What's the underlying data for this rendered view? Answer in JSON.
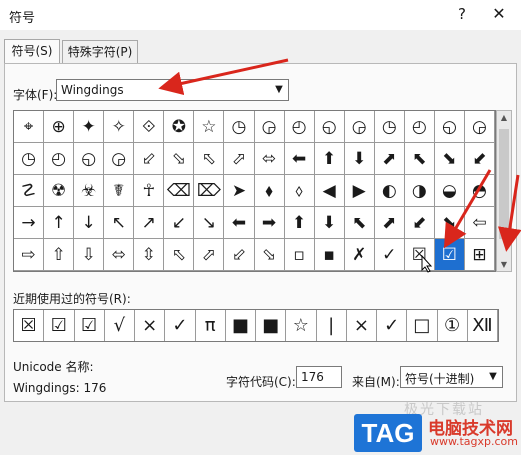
{
  "window": {
    "title": "符号",
    "help": "?",
    "close": "✕"
  },
  "tabs": [
    {
      "label": "符号(S)"
    },
    {
      "label": "特殊字符(P)"
    }
  ],
  "font": {
    "label": "字体(F):",
    "value": "Wingdings"
  },
  "symbol_grid": [
    [
      "⌖",
      "⊕",
      "✦",
      "✧",
      "⟐",
      "✪",
      "☆",
      "◷",
      "◶",
      "◴",
      "◵",
      "◶",
      "◷",
      "◴",
      "◵",
      "◶"
    ],
    [
      "◷",
      "◴",
      "◵",
      "◶",
      "⬃",
      "⬂",
      "⬁",
      "⬀",
      "⬄",
      "⬅",
      "⬆",
      "⬇",
      "⬈",
      "⬉",
      "⬊",
      "⬋"
    ],
    [
      "☡",
      "☢",
      "☣",
      "☤",
      "☥",
      "⌫",
      "⌦",
      "➤",
      "⬧",
      "⬨",
      "◀",
      "▶",
      "◐",
      "◑",
      "◒",
      "◓"
    ],
    [
      "→",
      "↑",
      "↓",
      "↖",
      "↗",
      "↙",
      "↘",
      "⬅",
      "➡",
      "⬆",
      "⬇",
      "⬉",
      "⬈",
      "⬋",
      "⬊",
      "⇦"
    ],
    [
      "⇨",
      "⇧",
      "⇩",
      "⬄",
      "⇳",
      "⬁",
      "⬀",
      "⬃",
      "⬂",
      "▫",
      "▪",
      "✗",
      "✓",
      "☒",
      "☑",
      "⊞"
    ]
  ],
  "selected_cell": "4,14",
  "recent": {
    "label": "近期使用过的符号(R):",
    "symbols": [
      "☒",
      "☑",
      "☑",
      "√",
      "×",
      "✓",
      "π",
      "■",
      "■",
      "☆",
      "|",
      "×",
      "✓",
      "□",
      "①",
      "Ⅻ"
    ]
  },
  "unicode": {
    "name_label": "Unicode 名称:",
    "value": "Wingdings: 176"
  },
  "charcode": {
    "label": "字符代码(C):",
    "value": "176"
  },
  "from": {
    "label": "来自(M):",
    "value": "符号(十进制)"
  },
  "watermark": {
    "logo": "TAG",
    "site_name": "电脑技术网",
    "url": "www.tagxp.com",
    "faint": "极光下载站"
  },
  "colors": {
    "selection": "#1e6fd0",
    "arrow": "#d9261c",
    "watermark_blue": "#1e74d6",
    "watermark_red": "#d93a2b"
  }
}
